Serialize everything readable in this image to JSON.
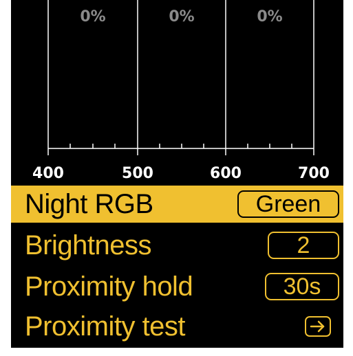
{
  "spectrum": {
    "bands": [
      {
        "label": "0%"
      },
      {
        "label": "0%"
      },
      {
        "label": "0%"
      }
    ],
    "axis": {
      "ticks": [
        "400",
        "500",
        "600",
        "700"
      ]
    },
    "colors": {
      "background": "#000000",
      "percent_text": "#8a8a8a",
      "axis": "#ffffff"
    }
  },
  "menu": {
    "accent_color": "#f0c030",
    "items": [
      {
        "label": "Night RGB",
        "value": "Green",
        "selected": true
      },
      {
        "label": "Brightness",
        "value": "2",
        "selected": false
      },
      {
        "label": "Proximity hold",
        "value": "30s",
        "selected": false
      },
      {
        "label": "Proximity test",
        "icon": "arrow-right-icon",
        "selected": false
      }
    ]
  }
}
